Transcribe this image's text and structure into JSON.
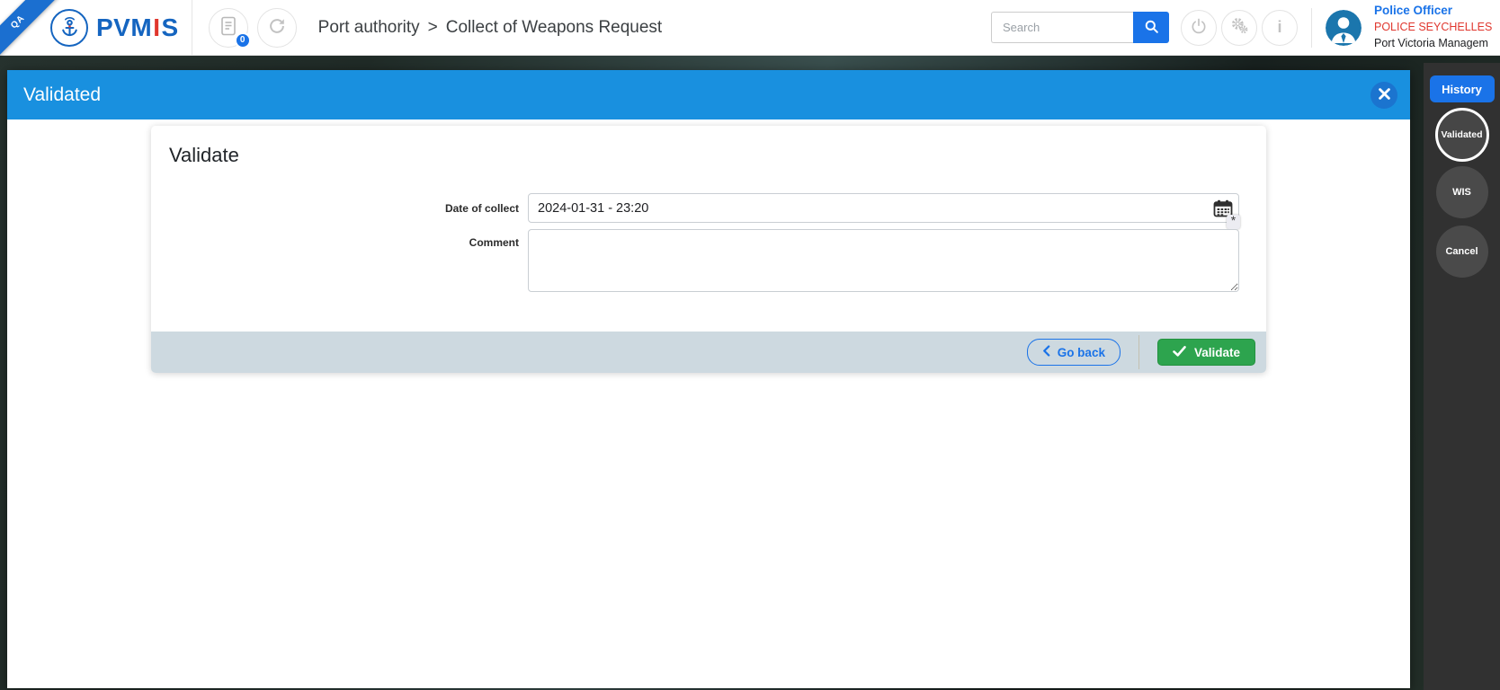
{
  "colors": {
    "accent_blue": "#1a73e8",
    "banner_blue": "#1990df",
    "brand_blue": "#1565c0",
    "alert_red": "#e0372e",
    "success_green": "#2da44e",
    "footer_bar_gray": "#cdd9e0",
    "sidebar_dark": "#313131"
  },
  "glyphs": {
    "info": "i",
    "required": "*"
  },
  "header": {
    "ribbon_label": "QA",
    "brand": {
      "part1": "PVM",
      "part2": "I",
      "part3": "S"
    },
    "doc_badge": "0",
    "breadcrumb": {
      "parts": [
        "Port authority",
        "Collect of Weapons Request"
      ],
      "separator": ">"
    },
    "search": {
      "placeholder": "Search"
    },
    "user": {
      "role": "Police Officer",
      "org": "POLICE SEYCHELLES",
      "entity": "Port Victoria Managem"
    }
  },
  "modal": {
    "banner_title": "Validated",
    "card": {
      "title": "Validate",
      "fields": [
        {
          "label": "Date of collect",
          "value": "2024-01-31 - 23:20",
          "required": true
        },
        {
          "label": "Comment",
          "value": ""
        }
      ],
      "footer": {
        "go_back_label": "Go back",
        "validate_label": "Validate"
      }
    }
  },
  "sidebar": {
    "history_label": "History",
    "steps": [
      {
        "label": "Validated",
        "active": true
      },
      {
        "label": "WIS",
        "active": false
      },
      {
        "label": "Cancel",
        "active": false
      }
    ]
  },
  "icons": {
    "anchor": "anchor-emblem",
    "documents": "document-sheet",
    "refresh": "circular-arrow",
    "search": "magnifier",
    "power": "power-symbol",
    "settings": "double-gear",
    "info": "letter-i",
    "user": "person-silhouette",
    "close": "x-cross",
    "calendar": "calendar-grid",
    "required": "asterisk",
    "chevron_left": "left-angle",
    "check": "checkmark"
  }
}
